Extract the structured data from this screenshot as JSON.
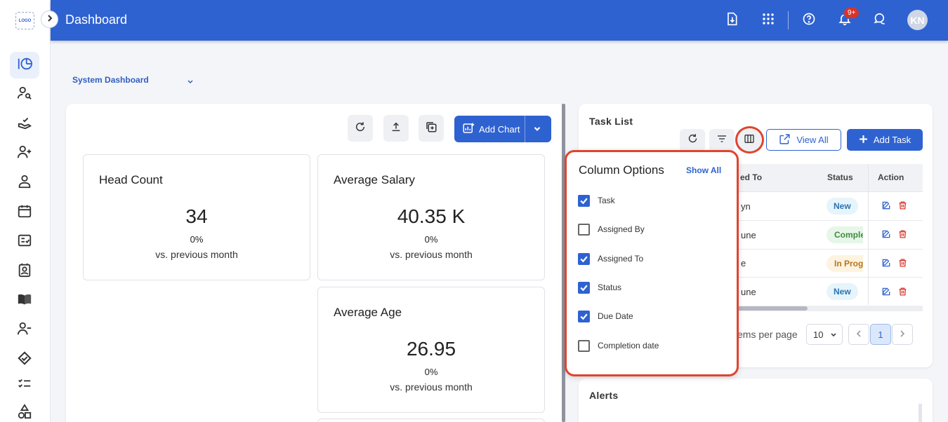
{
  "app": {
    "logo_text": "LOGO",
    "title": "Dashboard"
  },
  "header": {
    "notification_badge": "9+",
    "avatar_initials": "KN"
  },
  "dashboard_select": {
    "value": "System Dashboard"
  },
  "toolbar": {
    "add_chart_label": "Add Chart"
  },
  "stats": [
    {
      "title": "Head Count",
      "value": "34",
      "change": "0%",
      "caption": "vs. previous month"
    },
    {
      "title": "Average Salary",
      "value": "40.35 K",
      "change": "0%",
      "caption": "vs. previous month"
    },
    {
      "title": "Average Age",
      "value": "26.95",
      "change": "0%",
      "caption": "vs. previous month"
    }
  ],
  "task_list": {
    "title": "Task List",
    "view_all_label": "View All",
    "add_task_label": "Add Task",
    "columns": [
      "ed To",
      "Status",
      "Action"
    ],
    "rows": [
      {
        "assigned_to": "yn",
        "status": "New",
        "status_kind": "new"
      },
      {
        "assigned_to": "une",
        "status": "Complet",
        "status_kind": "complete"
      },
      {
        "assigned_to": "e",
        "status": "In Progre",
        "status_kind": "inprog"
      },
      {
        "assigned_to": "une",
        "status": "New",
        "status_kind": "new"
      }
    ],
    "items_per_page_label": "ems per page",
    "items_per_page_value": "10",
    "current_page": "1"
  },
  "alerts": {
    "title": "Alerts"
  },
  "column_options": {
    "title": "Column Options",
    "show_all_label": "Show All",
    "options": [
      {
        "label": "Task",
        "checked": true
      },
      {
        "label": "Assigned By",
        "checked": false
      },
      {
        "label": "Assigned To",
        "checked": true
      },
      {
        "label": "Status",
        "checked": true
      },
      {
        "label": "Due Date",
        "checked": true
      },
      {
        "label": "Completion date",
        "checked": false
      }
    ]
  },
  "colors": {
    "primary": "#2f62d1",
    "highlight": "#e0442d",
    "delete": "#d9342b"
  }
}
